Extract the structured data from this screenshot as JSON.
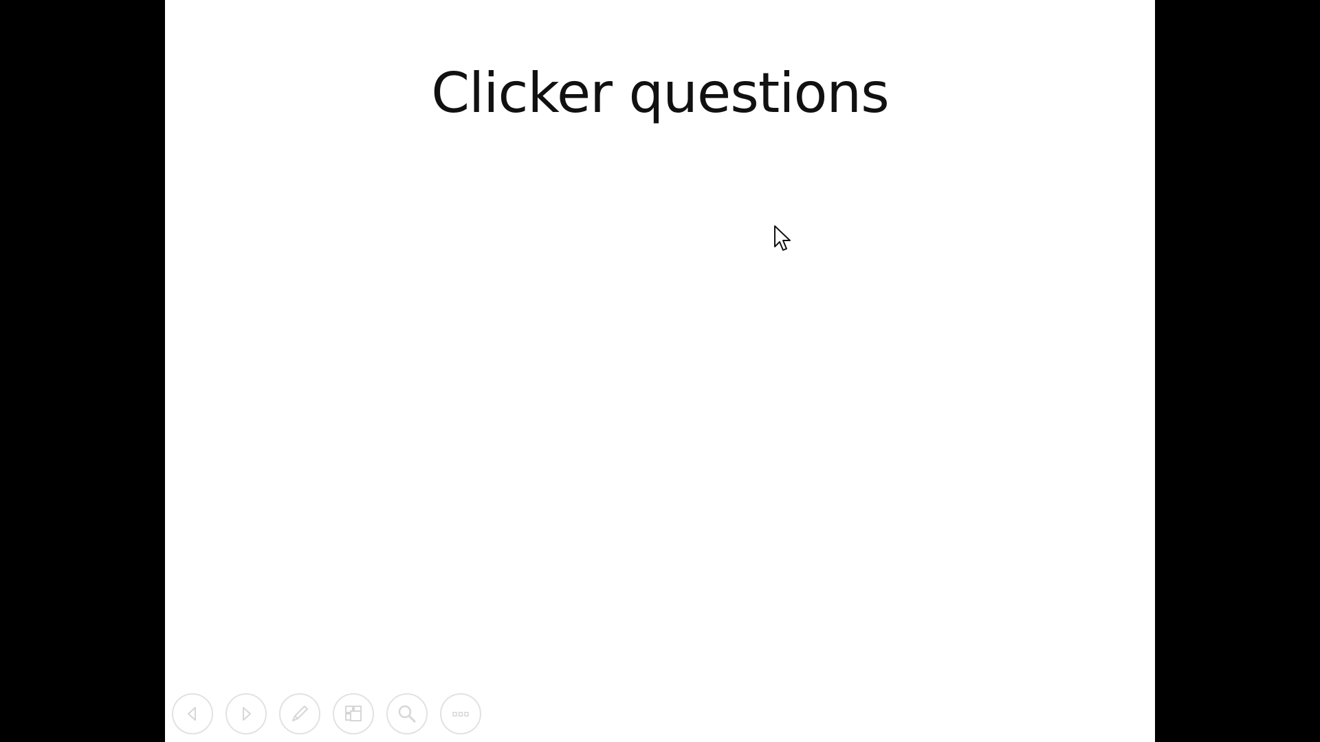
{
  "slide": {
    "title": "Clicker questions"
  },
  "controls": [
    {
      "name": "previous-slide-button",
      "icon": "chevron-left-icon"
    },
    {
      "name": "next-slide-button",
      "icon": "chevron-right-icon"
    },
    {
      "name": "pen-tool-button",
      "icon": "pen-icon"
    },
    {
      "name": "see-all-slides-button",
      "icon": "slides-grid-icon"
    },
    {
      "name": "zoom-button",
      "icon": "magnifier-icon"
    },
    {
      "name": "more-options-button",
      "icon": "more-dots-icon"
    }
  ],
  "colors": {
    "letterbox": "#000000",
    "slide_background": "#ffffff",
    "title_text": "#111111",
    "control_outline": "#e2e2e2"
  }
}
